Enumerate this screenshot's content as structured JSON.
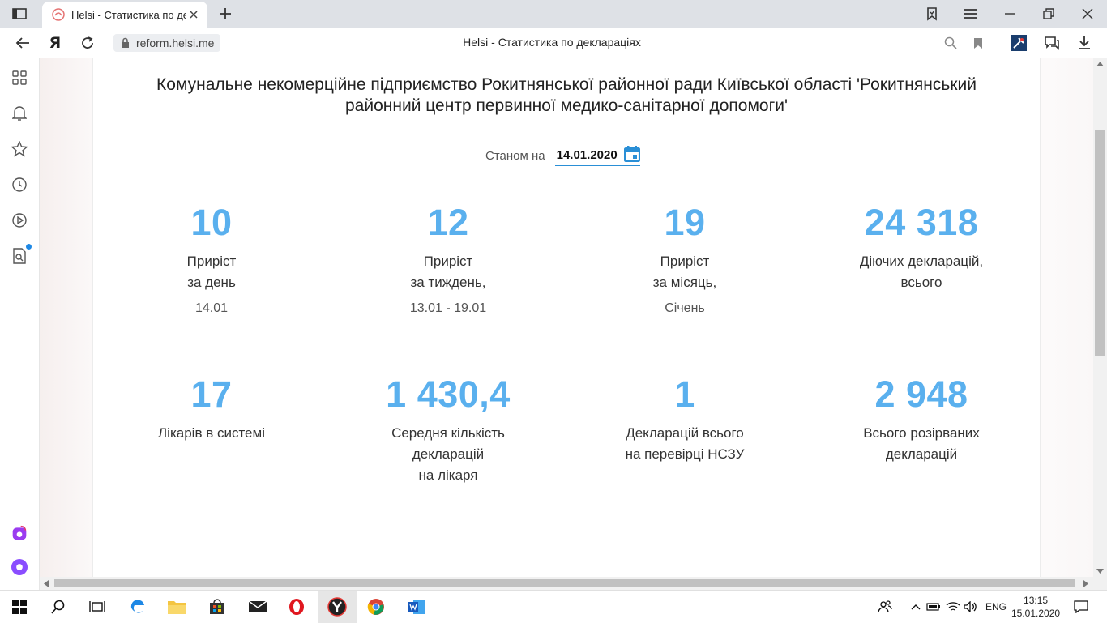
{
  "browser": {
    "tab_title": "Helsi - Статистика по де",
    "url": "reform.helsi.me",
    "page_title": "Helsi - Статистика по деклараціях",
    "ya_button": "Я"
  },
  "page": {
    "org_title": "Комунальне некомерційне підприємство Рокитнянської районної ради Київської області 'Рокитнянський районний центр первинної медико-санітарної допомоги'",
    "date_label": "Станом на",
    "date_value": "14.01.2020",
    "stats_row1": [
      {
        "value": "10",
        "label1": "Приріст",
        "label2": "за день",
        "sub": "14.01"
      },
      {
        "value": "12",
        "label1": "Приріст",
        "label2": "за тиждень,",
        "sub": "13.01 - 19.01"
      },
      {
        "value": "19",
        "label1": "Приріст",
        "label2": "за місяць,",
        "sub": "Січень"
      },
      {
        "value": "24 318",
        "label1": "Діючих декларацій,",
        "label2": "всього",
        "sub": ""
      }
    ],
    "stats_row2": [
      {
        "value": "17",
        "label1": "Лікарів в системі",
        "label2": "",
        "label3": ""
      },
      {
        "value": "1 430,4",
        "label1": "Середня кількість",
        "label2": "декларацій",
        "label3": "на лікаря"
      },
      {
        "value": "1",
        "label1": "Декларацій всього",
        "label2": "на перевірці НСЗУ",
        "label3": ""
      },
      {
        "value": "2 948",
        "label1": "Всього розірваних",
        "label2": "декларацій",
        "label3": ""
      }
    ]
  },
  "taskbar": {
    "language": "ENG",
    "time": "13:15",
    "date": "15.01.2020"
  },
  "colors": {
    "accent": "#5ab0ee",
    "link_blue": "#2a8fd6"
  }
}
